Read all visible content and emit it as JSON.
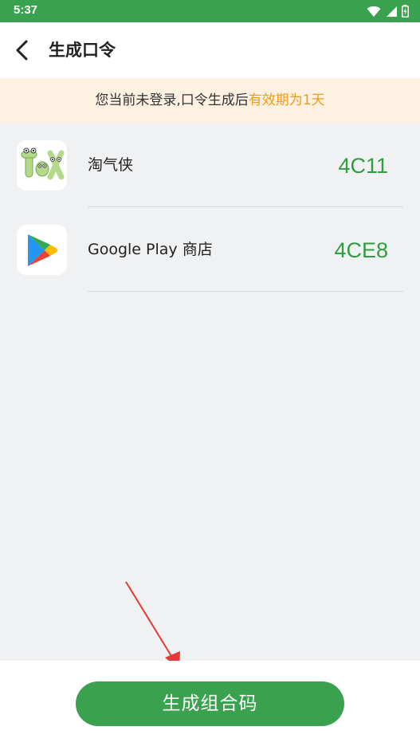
{
  "status_bar": {
    "time": "5:37",
    "icons": [
      "wifi-icon",
      "cellular-signal-icon",
      "battery-icon"
    ],
    "color": "#3aa24f"
  },
  "header": {
    "title": "生成口令",
    "back_icon": "chevron-left-icon"
  },
  "notice": {
    "text_prefix": "您当前未登录,口令生成后",
    "text_highlight": "有效期为1天",
    "highlight_color": "#f29a1a",
    "background": "#fdf1e2"
  },
  "apps": [
    {
      "name": "淘气侠",
      "code": "4C11",
      "icon": "taoqixia-app-icon"
    },
    {
      "name": "Google Play 商店",
      "code": "4CE8",
      "icon": "google-play-icon"
    }
  ],
  "footer": {
    "button_label": "生成组合码",
    "accent_color": "#3aa24f"
  }
}
